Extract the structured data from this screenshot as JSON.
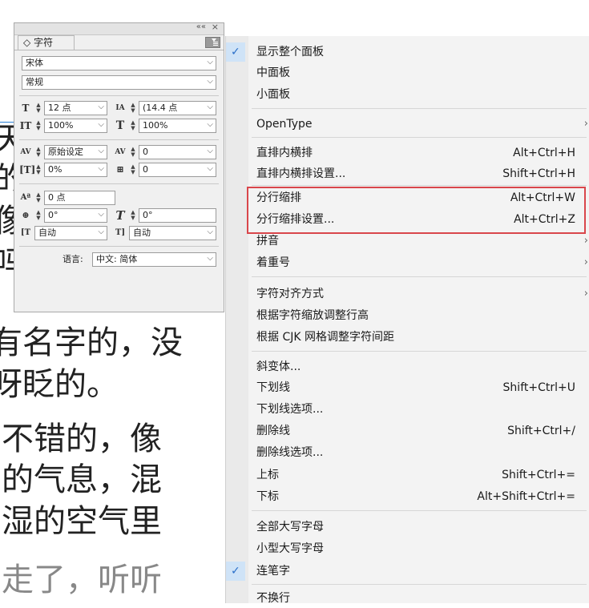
{
  "document": {
    "lines": [
      "天",
      "的",
      "像",
      "吗",
      "有名字的，没",
      "呀眨的。",
      "不错的，像",
      "的气息，混",
      "湿的空气里",
      "走了，听听"
    ]
  },
  "panel": {
    "title_icon": "diamond-arrows-icon",
    "tab_label": "◇ 字符",
    "collapse_icon": "««",
    "close_icon": "×",
    "font_family": "宋体",
    "font_style": "常规",
    "font_size": "12 点",
    "leading": "(14.4 点",
    "vertical_scale": "100%",
    "horizontal_scale": "100%",
    "kerning": "原始设定",
    "tracking": "0",
    "tsume": "0%",
    "aki": "0",
    "baseline_shift": "0 点",
    "rotation": "0°",
    "skew": "0°",
    "aki_before": "自动",
    "aki_after": "自动",
    "language_label": "语言:",
    "language": "中文: 简体"
  },
  "menu": {
    "items": [
      {
        "label": "显示整个面板",
        "shortcut": "",
        "checked": true
      },
      {
        "label": "中面板",
        "shortcut": ""
      },
      {
        "label": "小面板",
        "shortcut": ""
      },
      {
        "label": "OpenType",
        "shortcut": "",
        "submenu": true
      },
      {
        "label": "直排内横排",
        "shortcut": "Alt+Ctrl+H"
      },
      {
        "label": "直排内横排设置...",
        "shortcut": "Shift+Ctrl+H"
      },
      {
        "label": "分行缩排",
        "shortcut": "Alt+Ctrl+W"
      },
      {
        "label": "分行缩排设置...",
        "shortcut": "Alt+Ctrl+Z"
      },
      {
        "label": "拼音",
        "shortcut": "",
        "submenu": true
      },
      {
        "label": "着重号",
        "shortcut": "",
        "submenu": true
      },
      {
        "label": "字符对齐方式",
        "shortcut": "",
        "submenu": true
      },
      {
        "label": "根据字符缩放调整行高",
        "shortcut": ""
      },
      {
        "label": "根据 CJK 网格调整字符间距",
        "shortcut": ""
      },
      {
        "label": "斜变体...",
        "shortcut": ""
      },
      {
        "label": "下划线",
        "shortcut": "Shift+Ctrl+U"
      },
      {
        "label": "下划线选项...",
        "shortcut": ""
      },
      {
        "label": "删除线",
        "shortcut": "Shift+Ctrl+/"
      },
      {
        "label": "删除线选项...",
        "shortcut": ""
      },
      {
        "label": "上标",
        "shortcut": "Shift+Ctrl+="
      },
      {
        "label": "下标",
        "shortcut": "Alt+Shift+Ctrl+="
      },
      {
        "label": "全部大写字母",
        "shortcut": ""
      },
      {
        "label": "小型大写字母",
        "shortcut": ""
      },
      {
        "label": "连笔字",
        "shortcut": "",
        "checked_blue": true
      },
      {
        "label": "不换行",
        "shortcut": ""
      }
    ]
  },
  "colors": {
    "highlight_border": "#d9464b",
    "check_blue": "#2a6fc9"
  }
}
